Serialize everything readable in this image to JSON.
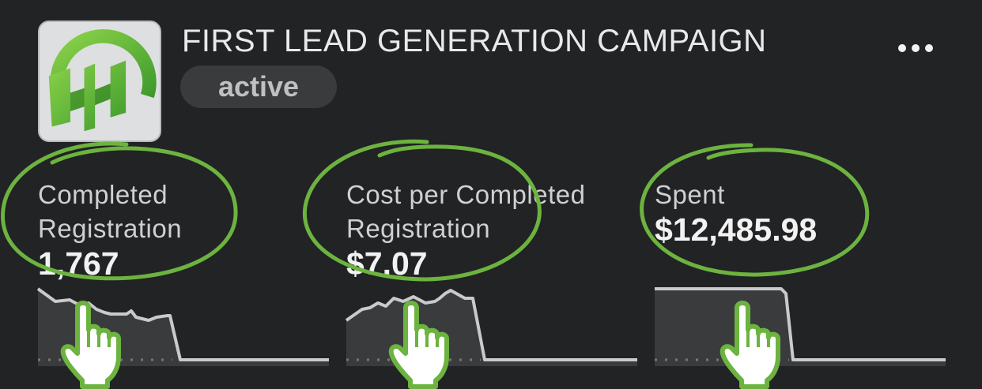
{
  "campaign": {
    "title": "FIRST LEAD GENERATION CAMPAIGN",
    "status": "active",
    "logo_icon": "green-building-circle-logo",
    "more_icon": "more-horizontal-icon"
  },
  "metrics": [
    {
      "label": "Completed\nRegistration",
      "value": "1,767"
    },
    {
      "label": "Cost per Completed\nRegistration",
      "value": "$7.07"
    },
    {
      "label": "Spent",
      "value": "$12,485.98"
    }
  ],
  "annotations": {
    "highlight_color": "#6cb33f",
    "pointer_icon": "hand-pointer-icon"
  },
  "colors": {
    "background": "#222325",
    "sparkline": "#c9cacc",
    "badge": "#3a3b3d"
  }
}
